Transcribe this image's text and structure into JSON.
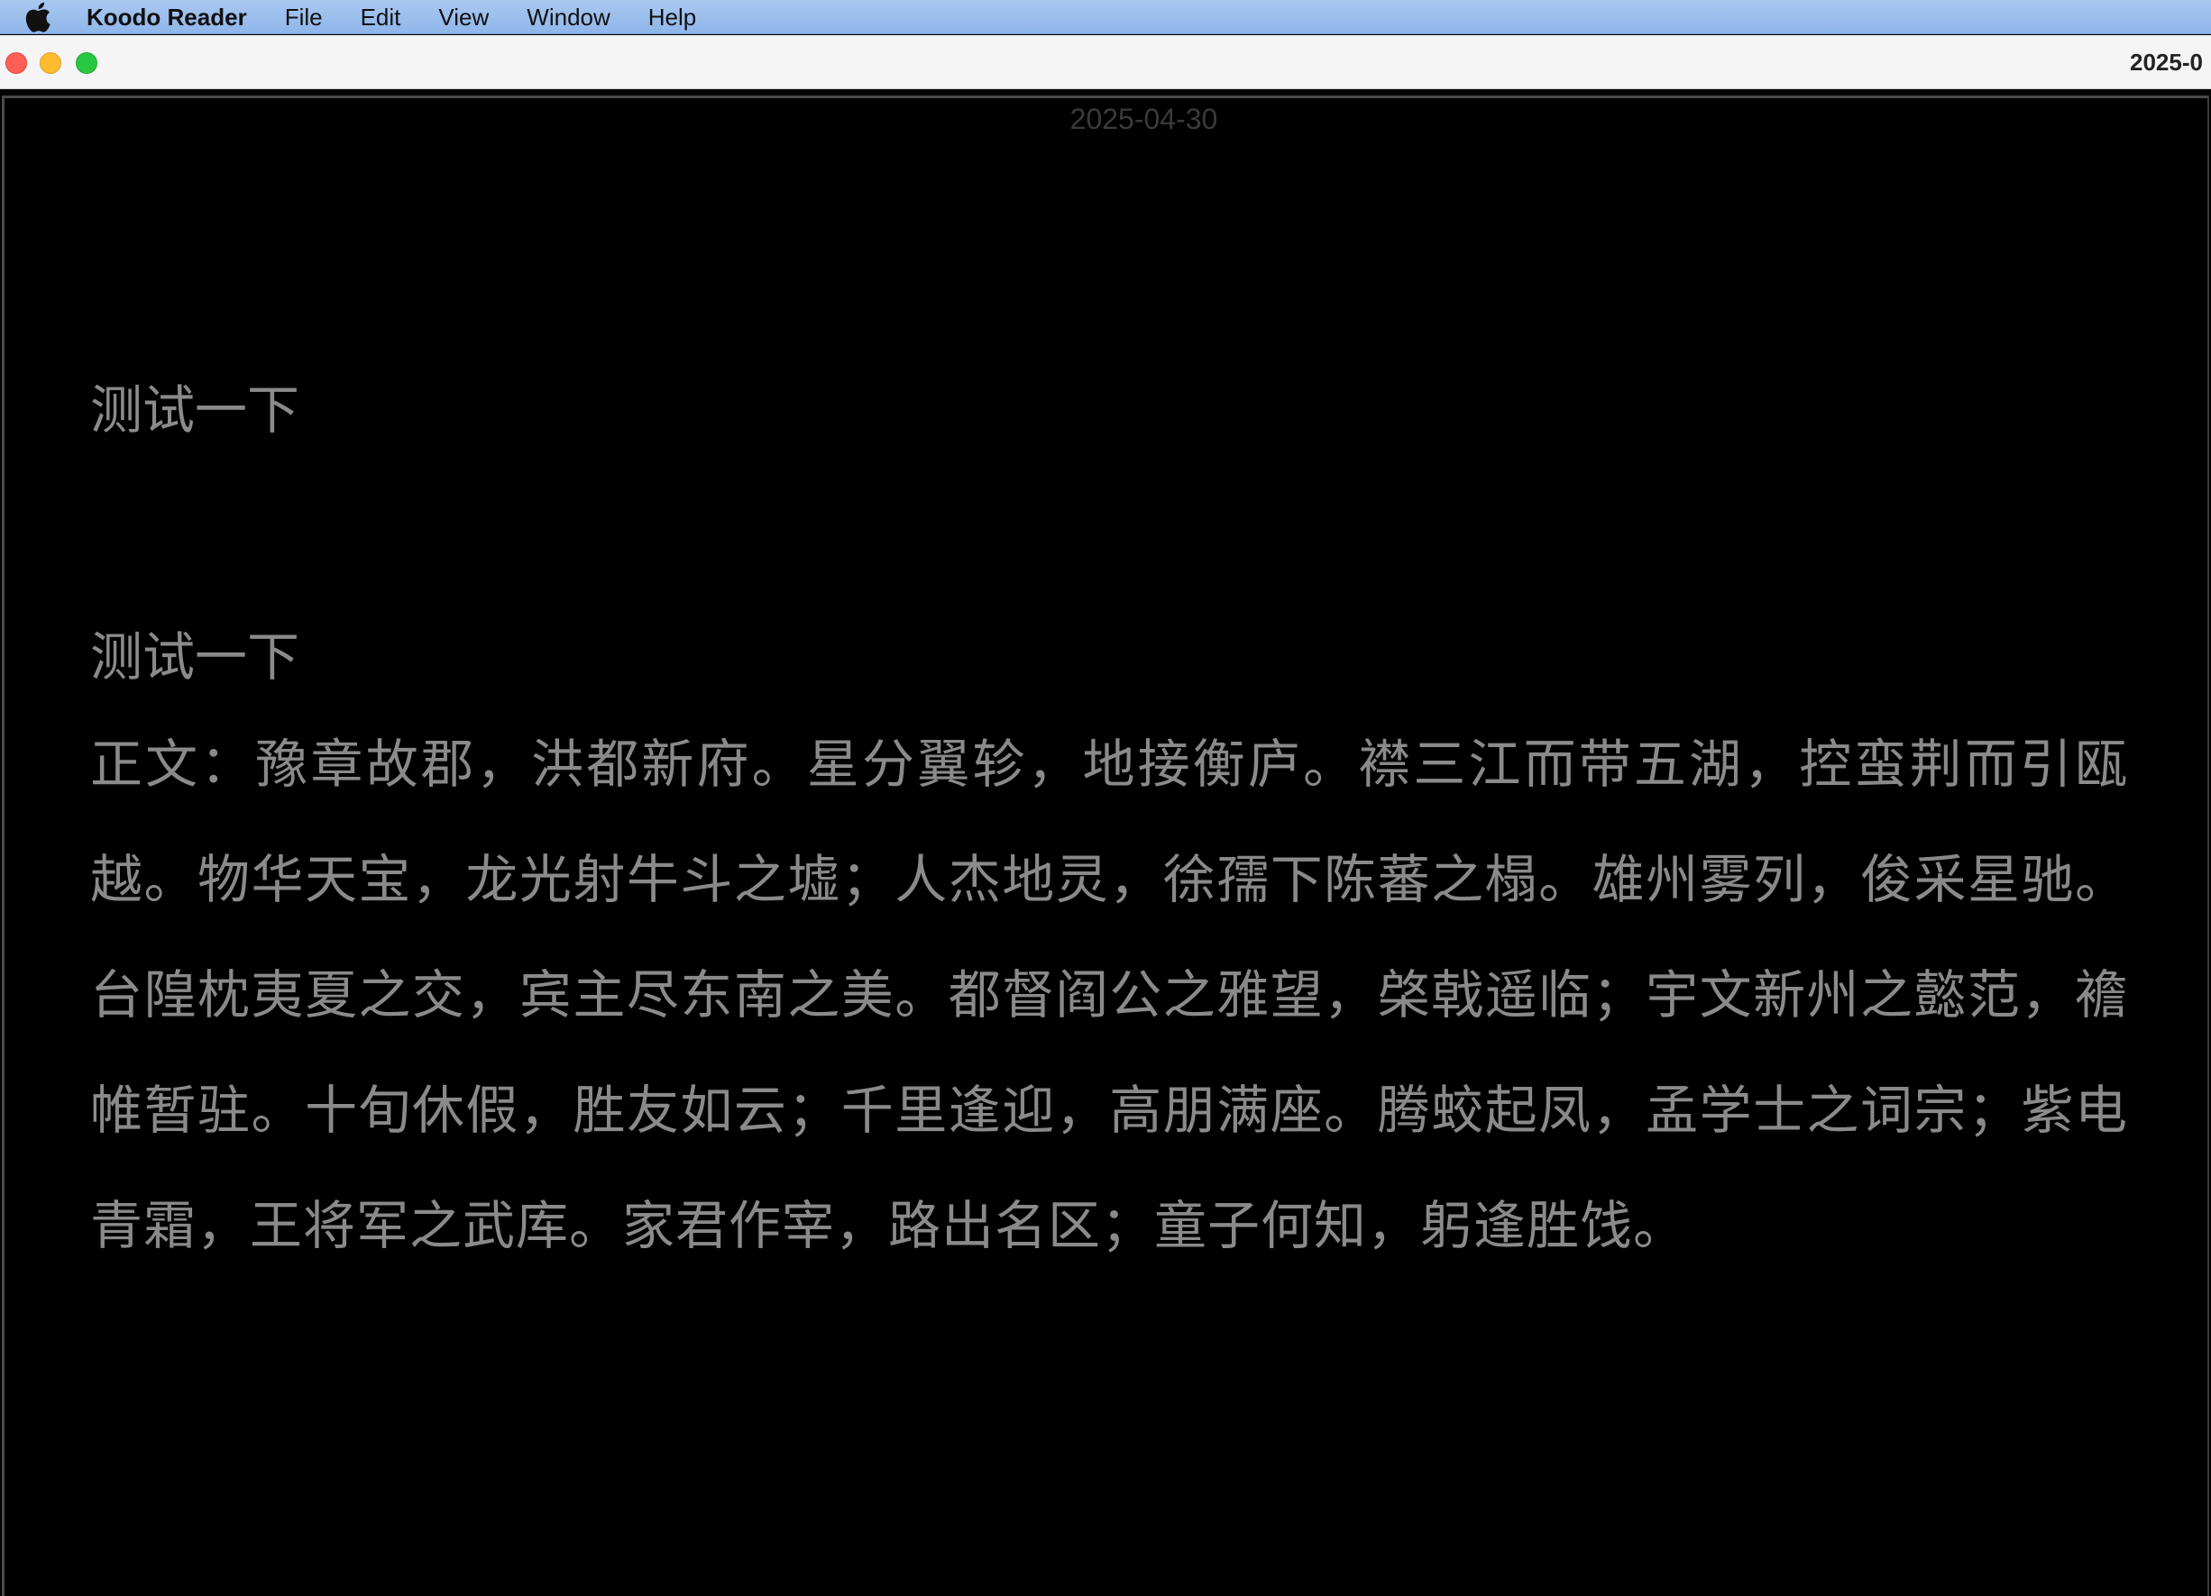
{
  "menubar": {
    "app_name": "Koodo Reader",
    "items": [
      "File",
      "Edit",
      "View",
      "Window",
      "Help"
    ]
  },
  "window": {
    "title": "2025-0"
  },
  "reader": {
    "page_date": "2025-04-30",
    "heading_1": "测试一下",
    "heading_2": "测试一下",
    "body": "正文：豫章故郡，洪都新府。星分翼轸，地接衡庐。襟三江而带五湖，控蛮荆而引瓯越。物华天宝，龙光射牛斗之墟；人杰地灵，徐孺下陈蕃之榻。雄州雾列，俊采星驰。台隍枕夷夏之交，宾主尽东南之美。都督阎公之雅望，棨戟遥临；宇文新州之懿范，襜帷暂驻。十旬休假，胜友如云；千里逢迎，高朋满座。腾蛟起凤，孟学士之词宗；紫电青霜，王将军之武库。家君作宰，路出名区；童子何知，躬逢胜饯。"
  },
  "icons": {
    "apple": "apple-logo-icon",
    "close": "close-window-icon",
    "minimize": "minimize-window-icon",
    "zoom": "zoom-window-icon"
  },
  "colors": {
    "menubar": "#a9c8f0",
    "reader_background": "#000000",
    "reader_text": "#8a8a8a",
    "close": "#ff5f57",
    "minimize": "#febc2e",
    "zoom": "#28c840"
  }
}
